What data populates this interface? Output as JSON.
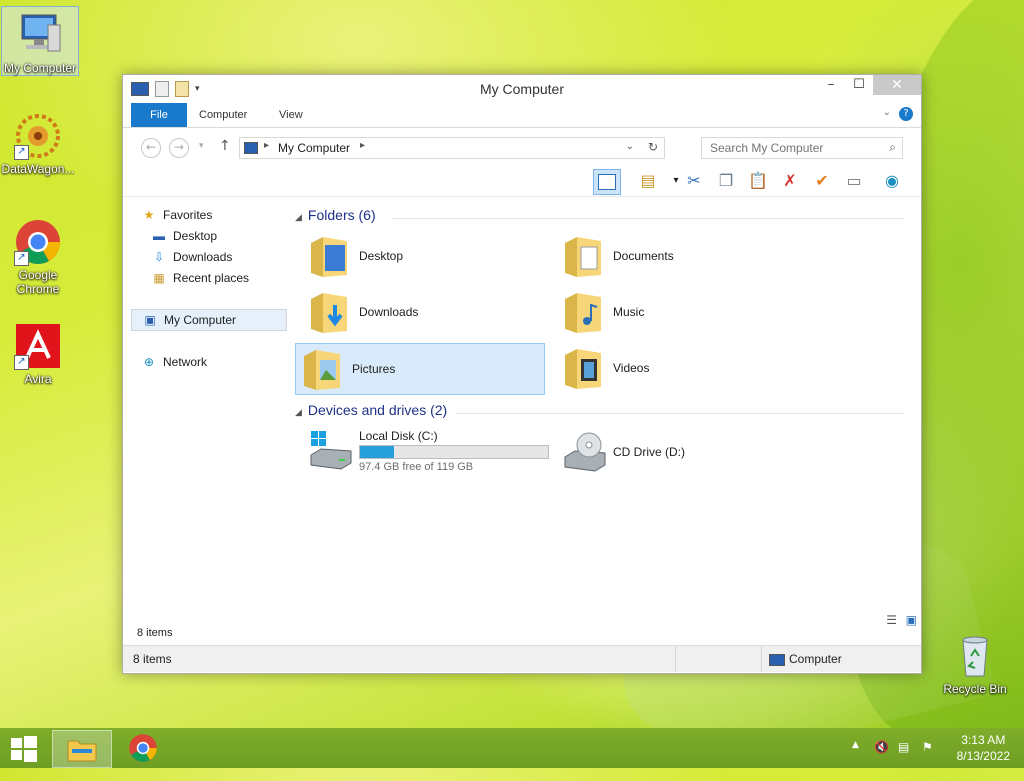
{
  "desktop": {
    "icons": [
      {
        "label": "My Computer",
        "icon": "computer-icon"
      },
      {
        "label": "DataWagon...",
        "icon": "datawagon-icon"
      },
      {
        "label": "Google Chrome",
        "icon": "chrome-icon"
      },
      {
        "label": "Avira",
        "icon": "avira-icon"
      },
      {
        "label": "Recycle Bin",
        "icon": "recycle-bin-icon"
      }
    ]
  },
  "window": {
    "title": "My Computer",
    "ribbon_tabs": [
      "File",
      "Computer",
      "View"
    ],
    "address": {
      "path": "My Computer"
    },
    "search": {
      "placeholder": "Search My Computer"
    },
    "nav": {
      "favorites": "Favorites",
      "favorites_items": [
        "Desktop",
        "Downloads",
        "Recent places"
      ],
      "computer": "My Computer",
      "network": "Network"
    },
    "groups": [
      {
        "title": "Folders (6)",
        "items": [
          "Desktop",
          "Documents",
          "Downloads",
          "Music",
          "Pictures",
          "Videos"
        ]
      },
      {
        "title": "Devices and drives (2)"
      }
    ],
    "drives": [
      {
        "name": "Local Disk (C:)",
        "free_text": "97.4 GB free of 119 GB",
        "used_fraction": 0.18
      },
      {
        "name": "CD Drive (D:)"
      }
    ],
    "status_items": "8 items",
    "status_items_bottom": "8 items",
    "status_location": "Computer"
  },
  "taskbar": {
    "time": "3:13 AM",
    "date": "8/13/2022"
  },
  "colors": {
    "file_tab": "#1979ca",
    "accent": "#26a0da",
    "selection": "#d9ebfa"
  }
}
